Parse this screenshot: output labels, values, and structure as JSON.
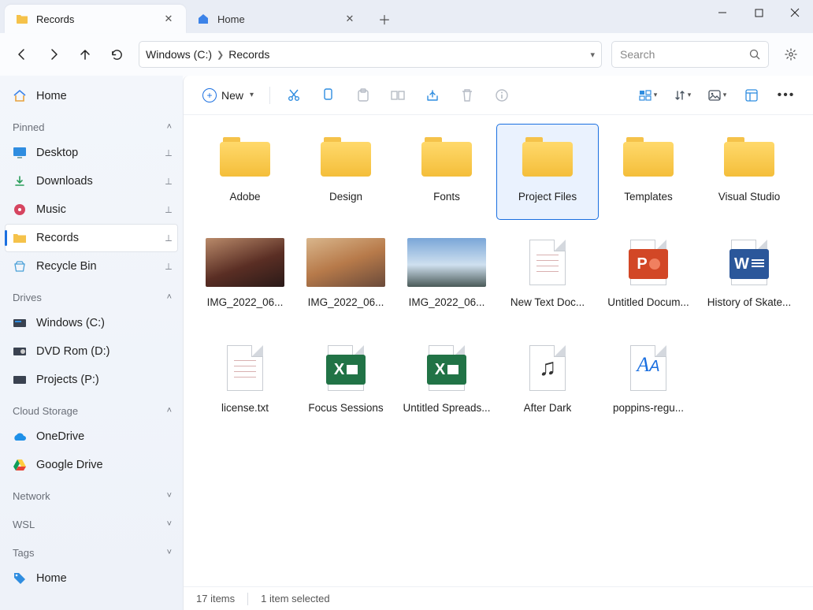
{
  "tabs": [
    {
      "label": "Records",
      "icon": "folder"
    },
    {
      "label": "Home",
      "icon": "home"
    }
  ],
  "active_tab": 0,
  "breadcrumb": [
    "Windows (C:)",
    "Records"
  ],
  "search_placeholder": "Search",
  "sidebar": {
    "home": "Home",
    "pinned_label": "Pinned",
    "pinned": [
      "Desktop",
      "Downloads",
      "Music",
      "Records",
      "Recycle Bin"
    ],
    "drives_label": "Drives",
    "drives": [
      "Windows (C:)",
      "DVD Rom (D:)",
      "Projects (P:)"
    ],
    "cloud_label": "Cloud Storage",
    "cloud": [
      "OneDrive",
      "Google Drive"
    ],
    "network_label": "Network",
    "wsl_label": "WSL",
    "tags_label": "Tags",
    "tags": [
      "Home"
    ]
  },
  "toolbar": {
    "new_label": "New"
  },
  "items": [
    {
      "label": "Adobe",
      "kind": "folder"
    },
    {
      "label": "Design",
      "kind": "folder"
    },
    {
      "label": "Fonts",
      "kind": "folder"
    },
    {
      "label": "Project Files",
      "kind": "folder",
      "selected": true
    },
    {
      "label": "Templates",
      "kind": "folder"
    },
    {
      "label": "Visual Studio",
      "kind": "folder"
    },
    {
      "label": "IMG_2022_06...",
      "kind": "image",
      "img": 1
    },
    {
      "label": "IMG_2022_06...",
      "kind": "image",
      "img": 2
    },
    {
      "label": "IMG_2022_06...",
      "kind": "image",
      "img": 3
    },
    {
      "label": "New Text Doc...",
      "kind": "text"
    },
    {
      "label": "Untitled Docum...",
      "kind": "ppt"
    },
    {
      "label": "History of Skate...",
      "kind": "word"
    },
    {
      "label": "license.txt",
      "kind": "text"
    },
    {
      "label": "Focus Sessions",
      "kind": "excel"
    },
    {
      "label": "Untitled Spreads...",
      "kind": "excel"
    },
    {
      "label": "After Dark",
      "kind": "audio"
    },
    {
      "label": "poppins-regu...",
      "kind": "font"
    }
  ],
  "status": {
    "count": "17 items",
    "selection": "1 item selected"
  }
}
